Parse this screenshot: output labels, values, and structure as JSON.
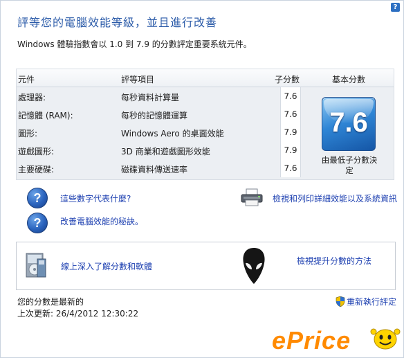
{
  "window": {
    "help_glyph": "?"
  },
  "header": {
    "title": "評等您的電腦效能等級，並且進行改善",
    "subtitle": "Windows 體驗指數會以 1.0 到 7.9 的分數評定重要系統元件。"
  },
  "table": {
    "columns": {
      "component": "元件",
      "rating": "評等項目",
      "subscore": "子分數",
      "base_score": "基本分數"
    },
    "rows": [
      {
        "component": "處理器:",
        "rating": "每秒資料計算量",
        "subscore": "7.6"
      },
      {
        "component": "記憶體 (RAM):",
        "rating": "每秒的記憶體運算",
        "subscore": "7.6"
      },
      {
        "component": "圖形:",
        "rating": "Windows Aero 的桌面效能",
        "subscore": "7.9"
      },
      {
        "component": "遊戲圖形:",
        "rating": "3D 商業和遊戲圖形效能",
        "subscore": "7.9"
      },
      {
        "component": "主要硬碟:",
        "rating": "磁碟資料傳送速率",
        "subscore": "7.6"
      }
    ],
    "base_score_value": "7.6",
    "base_score_caption_line1": "由最低子分數決",
    "base_score_caption_line2": "定"
  },
  "links": {
    "what_numbers_mean": "這些數字代表什麼?",
    "improve_tips": "改善電腦效能的秘訣。",
    "print_details": "檢視和列印詳細效能以及系統資訊",
    "learn_online": "線上深入了解分數和軟體",
    "view_raise": "檢視提升分數的方法"
  },
  "status": {
    "up_to_date": "您的分數是最新的",
    "last_updated": "上次更新: 26/4/2012 12:30:22",
    "rerun": "重新執行評定"
  },
  "watermark": {
    "text": "ePrice"
  },
  "icons": {
    "help": "help-icon",
    "question": "question-icon",
    "printer": "printer-icon",
    "software_box": "software-box-icon",
    "alien": "alienware-logo-icon",
    "shield": "uac-shield-icon"
  },
  "colors": {
    "title": "#2a5aa8",
    "link": "#1c3fb0",
    "badge": "#2f86d6",
    "watermark": "#ff8a00"
  }
}
